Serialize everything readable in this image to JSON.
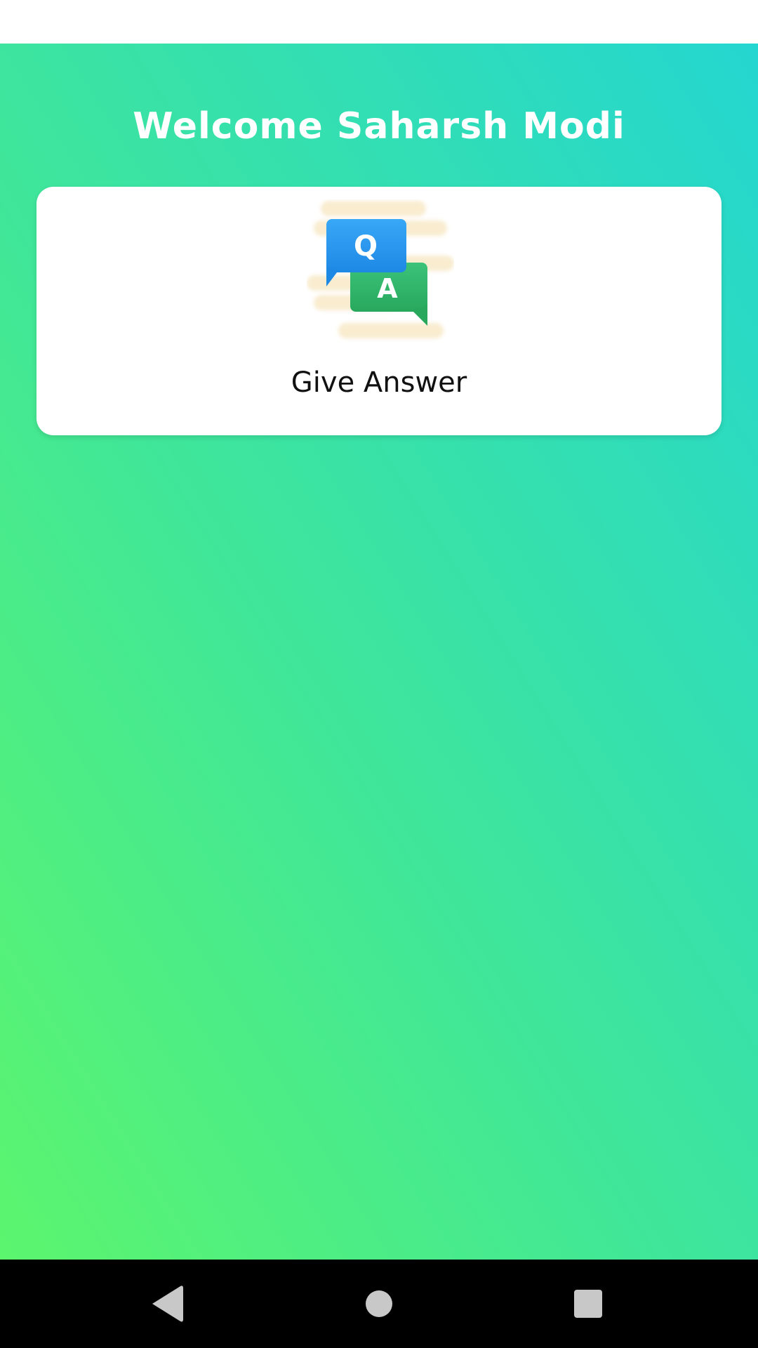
{
  "header": {
    "title": "Welcome Saharsh Modi"
  },
  "card": {
    "label": "Give Answer",
    "icon": "qa-chat-icon",
    "icon_letters": {
      "question": "Q",
      "answer": "A"
    }
  },
  "colors": {
    "gradient_bottom_left": "#5cf56e",
    "gradient_top_right": "#24d6d0",
    "question_bubble": "#2196f3",
    "answer_bubble": "#2eb86a"
  },
  "nav": {
    "back_icon": "back-triangle-icon",
    "home_icon": "home-circle-icon",
    "recents_icon": "recents-square-icon"
  }
}
